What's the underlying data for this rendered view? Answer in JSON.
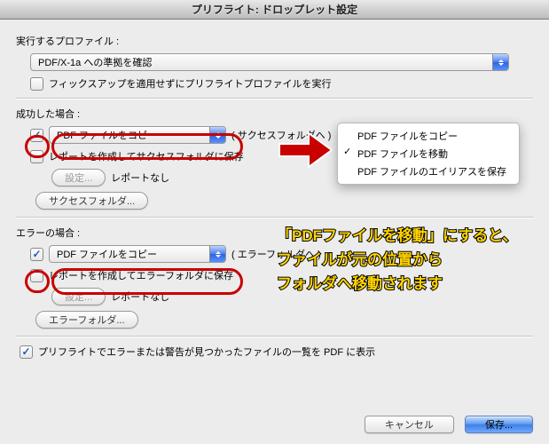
{
  "title": "プリフライト: ドロップレット設定",
  "profile": {
    "label": "実行するプロファイル :",
    "selected": "PDF/X-1a への準拠を確認",
    "noFixups": "フィックスアップを適用せずにプリフライトプロファイルを実行"
  },
  "success": {
    "heading": "成功した場合 :",
    "actionSelected": "PDF ファイルをコピー",
    "actionSuffix": "( サクセスフォルダへ )",
    "report": "レポートを作成してサクセスフォルダに保存",
    "settingsBtn": "設定...",
    "noReport": "レポートなし",
    "folderBtn": "サクセスフォルダ..."
  },
  "error": {
    "heading": "エラーの場合 :",
    "actionSelected": "PDF ファイルをコピー",
    "actionSuffix": "( エラーフォルダへ )",
    "report": "レポートを作成してエラーフォルダに保存",
    "settingsBtn": "設定...",
    "noReport": "レポートなし",
    "folderBtn": "エラーフォルダ..."
  },
  "showListCheckbox": "プリフライトでエラーまたは警告が見つかったファイルの一覧を PDF に表示",
  "buttons": {
    "cancel": "キャンセル",
    "save": "保存..."
  },
  "menu": {
    "items": [
      "PDF ファイルをコピー",
      "PDF ファイルを移動",
      "PDF ファイルのエイリアスを保存"
    ]
  },
  "annot": {
    "line1": "「PDFファイルを移動」にすると、",
    "line2": "ファイルが元の位置から",
    "line3": "フォルダへ移動されます"
  }
}
